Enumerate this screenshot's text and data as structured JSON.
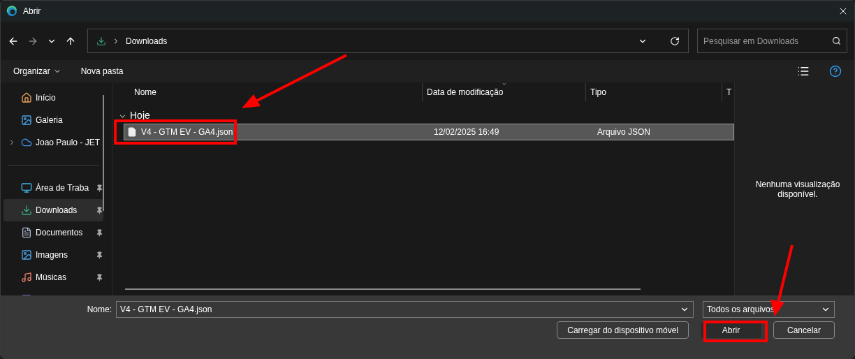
{
  "window": {
    "title": "Abrir"
  },
  "navigation": {
    "path": "Downloads",
    "search": {
      "placeholder": "Pesquisar em Downloads"
    }
  },
  "command_bar": {
    "organize": "Organizar",
    "new_folder": "Nova pasta"
  },
  "sidebar": {
    "items": [
      {
        "kind": "place",
        "label": "Início",
        "pinned": false,
        "selected": false,
        "expandable": false
      },
      {
        "kind": "place",
        "label": "Galeria",
        "pinned": false,
        "selected": false,
        "expandable": false
      },
      {
        "kind": "place",
        "label": "Joao Paulo - JET",
        "pinned": false,
        "selected": false,
        "expandable": true
      },
      {
        "kind": "divider"
      },
      {
        "kind": "place",
        "label": "Área de Traba",
        "pinned": true,
        "selected": false,
        "expandable": false
      },
      {
        "kind": "place",
        "label": "Downloads",
        "pinned": true,
        "selected": true,
        "expandable": false
      },
      {
        "kind": "place",
        "label": "Documentos",
        "pinned": true,
        "selected": false,
        "expandable": false
      },
      {
        "kind": "place",
        "label": "Imagens",
        "pinned": true,
        "selected": false,
        "expandable": false
      },
      {
        "kind": "place",
        "label": "Músicas",
        "pinned": true,
        "selected": false,
        "expandable": false
      },
      {
        "kind": "place",
        "selected": false
      }
    ]
  },
  "table": {
    "columns": [
      {
        "label": "Nome",
        "sorted": false
      },
      {
        "label": "Data de modificação",
        "sorted": true
      },
      {
        "label": "Tipo",
        "sorted": false
      },
      {
        "label": "T",
        "sorted": false
      }
    ],
    "groups": [
      {
        "label": "Hoje",
        "expanded": true,
        "rows": [
          {
            "name": "V4 - GTM EV - GA4.json",
            "modified": "12/02/2025 16:49",
            "type": "Arquivo JSON",
            "selected": true
          }
        ]
      }
    ]
  },
  "preview": {
    "message": "Nenhuma visualização disponível."
  },
  "footer": {
    "name_label": "Nome:",
    "name_value": "V4 - GTM EV - GA4.json",
    "filter": "Todos os arquivos",
    "buttons": [
      {
        "label": "Carregar do dispositivo móvel",
        "kind": "secondary"
      },
      {
        "label": "Abrir",
        "kind": "primary"
      },
      {
        "label": "Cancelar",
        "kind": "secondary"
      }
    ]
  }
}
